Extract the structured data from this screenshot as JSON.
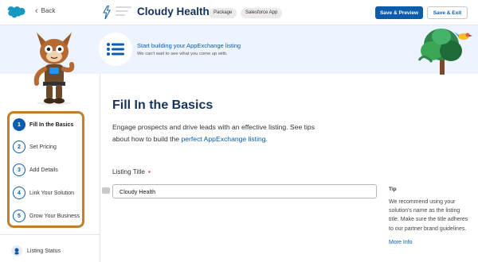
{
  "header": {
    "back_label": "Back",
    "app_title": "Cloudy Health",
    "badges": [
      "Package",
      "Salesforce App"
    ],
    "save_preview_label": "Save & Preview",
    "save_exit_label": "Save & Exit"
  },
  "banner": {
    "title": "Start building your AppExchange listing",
    "subtitle": "We can't wait to see what you come up with."
  },
  "steps": [
    {
      "number": "1",
      "label": "Fill In the Basics",
      "active": true
    },
    {
      "number": "2",
      "label": "Set Pricing",
      "active": false
    },
    {
      "number": "3",
      "label": "Add Details",
      "active": false
    },
    {
      "number": "4",
      "label": "Link Your Solution",
      "active": false
    },
    {
      "number": "5",
      "label": "Grow Your Business",
      "active": false
    }
  ],
  "sidebar": {
    "status_label": "Listing Status"
  },
  "main": {
    "title": "Fill In the Basics",
    "intro_text": "Engage prospects and drive leads with an effective listing. See tips about how to build the ",
    "intro_link": "perfect AppExchange listing",
    "intro_end": ".",
    "field_label": "Listing Title",
    "field_required_mark": "•",
    "field_value": "Cloudy Health"
  },
  "tip": {
    "heading": "Tip",
    "body": "We recommend using your solution's name as the listing title. Make sure the title adheres to our partner brand guidelines.",
    "more_link": "More Info"
  },
  "colors": {
    "brand_blue": "#0b5cab",
    "heading_navy": "#16325c",
    "banner_bg": "#eef4ff",
    "highlight_border": "#c1802a"
  }
}
